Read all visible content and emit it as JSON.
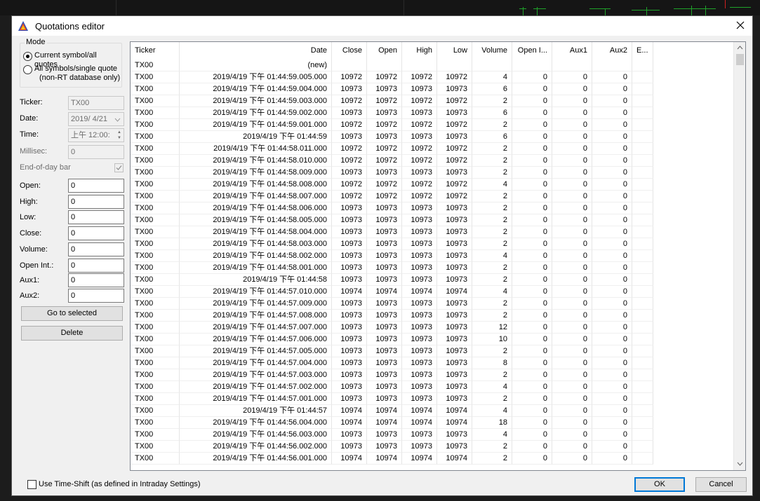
{
  "window": {
    "title": "Quotations editor"
  },
  "mode": {
    "title": "Mode",
    "option1": "Current symbol/all quotes",
    "option2_line1": "All symbols/single quote",
    "option2_line2": "(non-RT database only)"
  },
  "form": {
    "ticker_label": "Ticker:",
    "ticker_value": "TX00",
    "date_label": "Date:",
    "date_value": "2019/  4/21",
    "time_label": "Time:",
    "time_value": "上午 12:00:",
    "millisec_label": "Millisec:",
    "millisec_value": "0",
    "eod_label": "End-of-day bar",
    "open_label": "Open:",
    "open_value": "0",
    "high_label": "High:",
    "high_value": "0",
    "low_label": "Low:",
    "low_value": "0",
    "close_label": "Close:",
    "close_value": "0",
    "volume_label": "Volume:",
    "volume_value": "0",
    "openint_label": "Open Int.:",
    "openint_value": "0",
    "aux1_label": "Aux1:",
    "aux1_value": "0",
    "aux2_label": "Aux2:",
    "aux2_value": "0"
  },
  "buttons": {
    "goto": "Go to selected",
    "delete": "Delete",
    "ok": "OK",
    "cancel": "Cancel"
  },
  "timeshift_label": "Use Time-Shift (as defined in Intraday Settings)",
  "table": {
    "columns": [
      "Ticker",
      "Date",
      "Close",
      "Open",
      "High",
      "Low",
      "Volume",
      "Open I...",
      "Aux1",
      "Aux2",
      "E..."
    ],
    "rows": [
      [
        "TX00",
        "(new)",
        "",
        "",
        "",
        "",
        "",
        "",
        "",
        ""
      ],
      [
        "TX00",
        "2019/4/19 下午 01:44:59.005.000",
        "10972",
        "10972",
        "10972",
        "10972",
        "4",
        "0",
        "0",
        "0"
      ],
      [
        "TX00",
        "2019/4/19 下午 01:44:59.004.000",
        "10973",
        "10973",
        "10973",
        "10973",
        "6",
        "0",
        "0",
        "0"
      ],
      [
        "TX00",
        "2019/4/19 下午 01:44:59.003.000",
        "10972",
        "10972",
        "10972",
        "10972",
        "2",
        "0",
        "0",
        "0"
      ],
      [
        "TX00",
        "2019/4/19 下午 01:44:59.002.000",
        "10973",
        "10973",
        "10973",
        "10973",
        "6",
        "0",
        "0",
        "0"
      ],
      [
        "TX00",
        "2019/4/19 下午 01:44:59.001.000",
        "10972",
        "10972",
        "10972",
        "10972",
        "2",
        "0",
        "0",
        "0"
      ],
      [
        "TX00",
        "2019/4/19 下午 01:44:59",
        "10973",
        "10973",
        "10973",
        "10973",
        "6",
        "0",
        "0",
        "0"
      ],
      [
        "TX00",
        "2019/4/19 下午 01:44:58.011.000",
        "10972",
        "10972",
        "10972",
        "10972",
        "2",
        "0",
        "0",
        "0"
      ],
      [
        "TX00",
        "2019/4/19 下午 01:44:58.010.000",
        "10972",
        "10972",
        "10972",
        "10972",
        "2",
        "0",
        "0",
        "0"
      ],
      [
        "TX00",
        "2019/4/19 下午 01:44:58.009.000",
        "10973",
        "10973",
        "10973",
        "10973",
        "2",
        "0",
        "0",
        "0"
      ],
      [
        "TX00",
        "2019/4/19 下午 01:44:58.008.000",
        "10972",
        "10972",
        "10972",
        "10972",
        "4",
        "0",
        "0",
        "0"
      ],
      [
        "TX00",
        "2019/4/19 下午 01:44:58.007.000",
        "10972",
        "10972",
        "10972",
        "10972",
        "2",
        "0",
        "0",
        "0"
      ],
      [
        "TX00",
        "2019/4/19 下午 01:44:58.006.000",
        "10973",
        "10973",
        "10973",
        "10973",
        "2",
        "0",
        "0",
        "0"
      ],
      [
        "TX00",
        "2019/4/19 下午 01:44:58.005.000",
        "10973",
        "10973",
        "10973",
        "10973",
        "2",
        "0",
        "0",
        "0"
      ],
      [
        "TX00",
        "2019/4/19 下午 01:44:58.004.000",
        "10973",
        "10973",
        "10973",
        "10973",
        "2",
        "0",
        "0",
        "0"
      ],
      [
        "TX00",
        "2019/4/19 下午 01:44:58.003.000",
        "10973",
        "10973",
        "10973",
        "10973",
        "2",
        "0",
        "0",
        "0"
      ],
      [
        "TX00",
        "2019/4/19 下午 01:44:58.002.000",
        "10973",
        "10973",
        "10973",
        "10973",
        "4",
        "0",
        "0",
        "0"
      ],
      [
        "TX00",
        "2019/4/19 下午 01:44:58.001.000",
        "10973",
        "10973",
        "10973",
        "10973",
        "2",
        "0",
        "0",
        "0"
      ],
      [
        "TX00",
        "2019/4/19 下午 01:44:58",
        "10973",
        "10973",
        "10973",
        "10973",
        "2",
        "0",
        "0",
        "0"
      ],
      [
        "TX00",
        "2019/4/19 下午 01:44:57.010.000",
        "10974",
        "10974",
        "10974",
        "10974",
        "4",
        "0",
        "0",
        "0"
      ],
      [
        "TX00",
        "2019/4/19 下午 01:44:57.009.000",
        "10973",
        "10973",
        "10973",
        "10973",
        "2",
        "0",
        "0",
        "0"
      ],
      [
        "TX00",
        "2019/4/19 下午 01:44:57.008.000",
        "10973",
        "10973",
        "10973",
        "10973",
        "2",
        "0",
        "0",
        "0"
      ],
      [
        "TX00",
        "2019/4/19 下午 01:44:57.007.000",
        "10973",
        "10973",
        "10973",
        "10973",
        "12",
        "0",
        "0",
        "0"
      ],
      [
        "TX00",
        "2019/4/19 下午 01:44:57.006.000",
        "10973",
        "10973",
        "10973",
        "10973",
        "10",
        "0",
        "0",
        "0"
      ],
      [
        "TX00",
        "2019/4/19 下午 01:44:57.005.000",
        "10973",
        "10973",
        "10973",
        "10973",
        "2",
        "0",
        "0",
        "0"
      ],
      [
        "TX00",
        "2019/4/19 下午 01:44:57.004.000",
        "10973",
        "10973",
        "10973",
        "10973",
        "8",
        "0",
        "0",
        "0"
      ],
      [
        "TX00",
        "2019/4/19 下午 01:44:57.003.000",
        "10973",
        "10973",
        "10973",
        "10973",
        "2",
        "0",
        "0",
        "0"
      ],
      [
        "TX00",
        "2019/4/19 下午 01:44:57.002.000",
        "10973",
        "10973",
        "10973",
        "10973",
        "4",
        "0",
        "0",
        "0"
      ],
      [
        "TX00",
        "2019/4/19 下午 01:44:57.001.000",
        "10973",
        "10973",
        "10973",
        "10973",
        "2",
        "0",
        "0",
        "0"
      ],
      [
        "TX00",
        "2019/4/19 下午 01:44:57",
        "10974",
        "10974",
        "10974",
        "10974",
        "4",
        "0",
        "0",
        "0"
      ],
      [
        "TX00",
        "2019/4/19 下午 01:44:56.004.000",
        "10974",
        "10974",
        "10974",
        "10974",
        "18",
        "0",
        "0",
        "0"
      ],
      [
        "TX00",
        "2019/4/19 下午 01:44:56.003.000",
        "10973",
        "10973",
        "10973",
        "10973",
        "4",
        "0",
        "0",
        "0"
      ],
      [
        "TX00",
        "2019/4/19 下午 01:44:56.002.000",
        "10973",
        "10973",
        "10973",
        "10973",
        "2",
        "0",
        "0",
        "0"
      ],
      [
        "TX00",
        "2019/4/19 下午 01:44:56.001.000",
        "10974",
        "10974",
        "10974",
        "10974",
        "2",
        "0",
        "0",
        "0"
      ]
    ]
  },
  "colors": {
    "accent": "#0078d7",
    "chart_tick": "#1fa32a"
  },
  "icons": {
    "app": "amibroker-logo-icon",
    "close": "close-icon"
  }
}
